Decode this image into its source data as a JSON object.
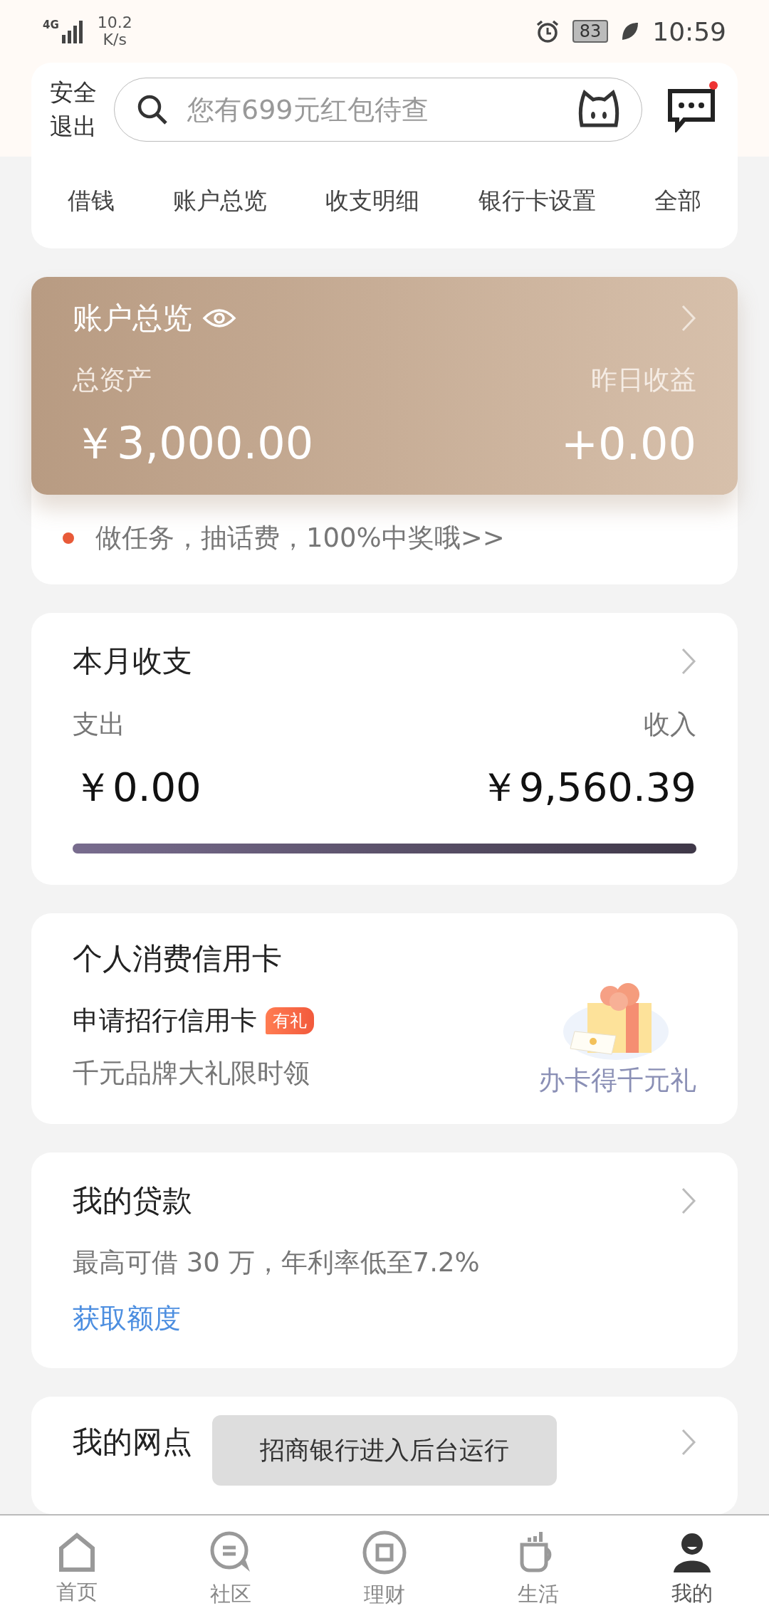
{
  "status_bar": {
    "network": "4G",
    "speed_value": "10.2",
    "speed_unit": "K/s",
    "battery": "83",
    "time": "10:59"
  },
  "header": {
    "logout": "安全退出",
    "search": {
      "placeholder": "您有699元红包待查"
    },
    "messages": {
      "unread": true
    }
  },
  "shortcuts": [
    "借钱",
    "账户总览",
    "收支明细",
    "银行卡设置",
    "全部"
  ],
  "account": {
    "title": "账户总览",
    "assets_label": "总资产",
    "assets": "￥3,000.00",
    "yield_label": "昨日收益",
    "yield": "+0.00",
    "promo": "做任务，抽话费，100%中奖哦>>"
  },
  "monthly": {
    "title": "本月收支",
    "expense_label": "支出",
    "income_label": "收入",
    "expense": "￥0.00",
    "income": "￥9,560.39",
    "level": 1
  },
  "credit": {
    "title": "个人消费信用卡",
    "apply": "申请招行信用卡",
    "badge": "有礼",
    "subtitle": "千元品牌大礼限时领",
    "gift_caption": "办卡得千元礼"
  },
  "loan": {
    "title": "我的贷款",
    "text": "最高可借 30 万，年利率低至7.2%",
    "link": "获取额度"
  },
  "outlets": {
    "title": "我的网点"
  },
  "toast": "招商银行进入后台运行",
  "tabs": [
    {
      "label": "首页",
      "kind": "home",
      "selected": false
    },
    {
      "label": "社区",
      "kind": "community",
      "selected": false
    },
    {
      "label": "理财",
      "kind": "finance",
      "selected": false
    },
    {
      "label": "生活",
      "kind": "life",
      "selected": false
    },
    {
      "label": "我的",
      "kind": "me",
      "selected": true
    }
  ]
}
